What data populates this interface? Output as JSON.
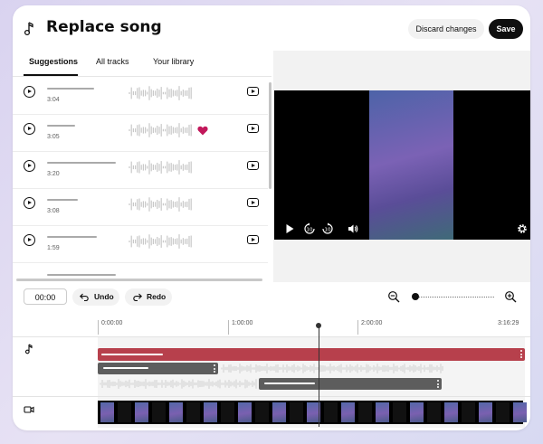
{
  "header": {
    "title": "Replace song",
    "discard_label": "Discard changes",
    "save_label": "Save"
  },
  "tabs": [
    {
      "label": "Suggestions",
      "active": true
    },
    {
      "label": "All tracks",
      "active": false
    },
    {
      "label": "Your library",
      "active": false
    }
  ],
  "tracks": [
    {
      "duration": "3:04",
      "liked": false
    },
    {
      "duration": "3:05",
      "liked": true
    },
    {
      "duration": "3:20",
      "liked": false
    },
    {
      "duration": "3:08",
      "liked": false
    },
    {
      "duration": "1:59",
      "liked": false
    },
    {
      "duration": "",
      "liked": false
    }
  ],
  "editor": {
    "current_time": "00:00",
    "undo_label": "Undo",
    "redo_label": "Redo",
    "zoom_level": 0.0
  },
  "timeline": {
    "markers": [
      "0:00:00",
      "1:00:00",
      "2:00:00",
      "3:16:29"
    ]
  },
  "colors": {
    "song_track": "#b7404c",
    "heart": "#c2185b",
    "save_button": "#0f0f0f"
  },
  "icons": {
    "header": "music-note-icon",
    "row_play": "play-circle-icon",
    "row_preview": "youtube-preview-icon",
    "favorite": "heart-icon",
    "undo": "undo-icon",
    "redo": "redo-icon",
    "zoom_out": "zoom-out-icon",
    "zoom_in": "zoom-in-icon",
    "audio_lane": "music-note-icon",
    "video_lane": "video-camera-icon",
    "settings": "gear-icon"
  }
}
